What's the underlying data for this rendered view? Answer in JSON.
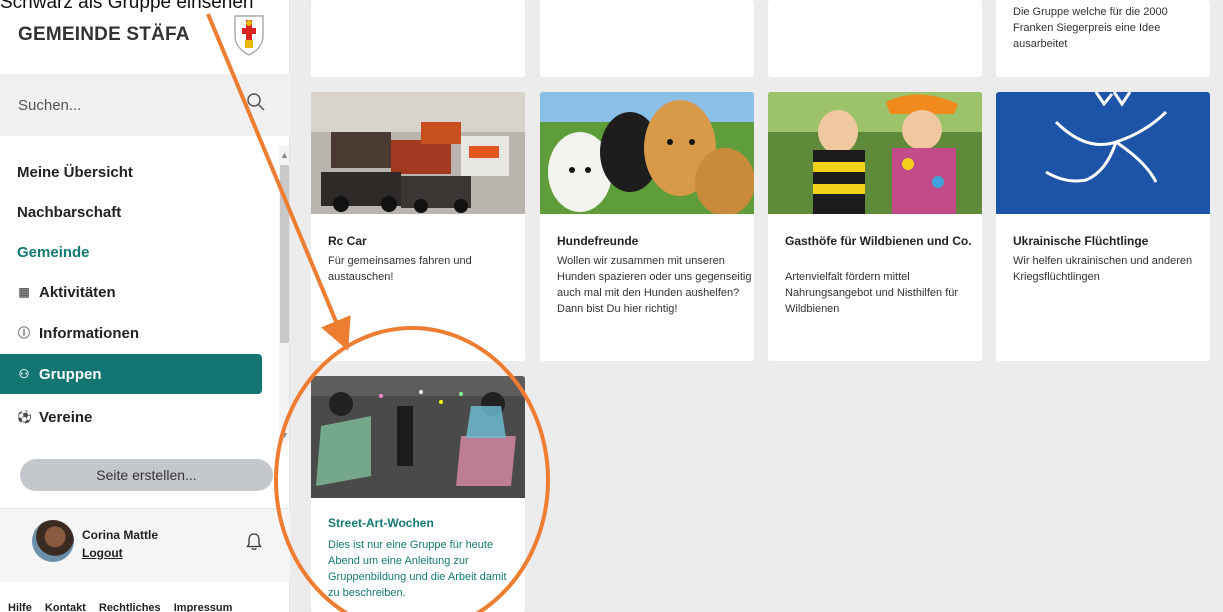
{
  "annotation_text": "Schwarz als Gruppe einsehen",
  "brand": {
    "name": "GEMEINDE STÄFA"
  },
  "search": {
    "placeholder": "Suchen..."
  },
  "nav": {
    "overview": "Meine Übersicht",
    "neighborhood": "Nachbarschaft",
    "community": "Gemeinde",
    "activities": "Aktivitäten",
    "information": "Informationen",
    "groups": "Gruppen",
    "clubs": "Vereine"
  },
  "create_page": "Seite erstellen...",
  "user": {
    "name": "Corina Mattle",
    "logout": "Logout"
  },
  "footer": [
    "Hilfe",
    "Kontakt",
    "Rechtliches",
    "Impressum"
  ],
  "top_card_text": "Die Gruppe welche für die 2000 Franken Siegerpreis eine Idee ausarbeitet",
  "cards": [
    {
      "title": "Rc Car",
      "desc": "Für gemeinsames fahren und austauschen!"
    },
    {
      "title": "Hundefreunde",
      "desc": "Wollen wir zusammen mit unseren Hunden spazieren oder uns gegenseitig auch mal mit den Hunden aushelfen? Dann bist Du hier richtig!"
    },
    {
      "title": "Gasthöfe für Wildbienen und Co.",
      "desc": "Artenvielfalt fördern mittel Nahrungsangebot und Nisthilfen für Wildbienen"
    },
    {
      "title": "Ukrainische Flüchtlinge",
      "desc": "Wir helfen ukrainischen und anderen Kriegsflüchtlingen"
    },
    {
      "title": "Street-Art-Wochen",
      "desc": "Dies ist nur eine Gruppe für heute Abend um eine Anleitung zur Gruppenbildung und die Arbeit damit zu beschreiben."
    }
  ],
  "colors": {
    "accent": "#137571",
    "annotation": "#ed7d31"
  }
}
